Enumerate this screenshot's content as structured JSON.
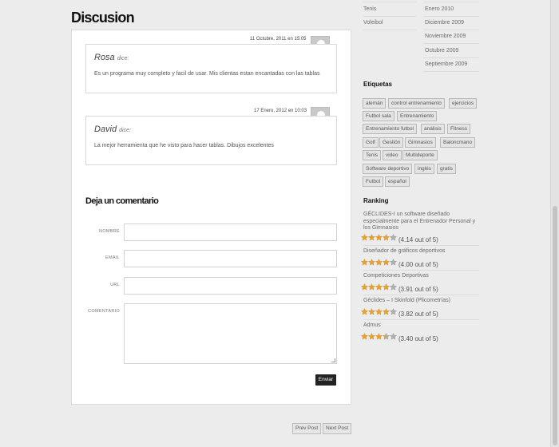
{
  "page": {
    "title": "Discusion"
  },
  "comments": [
    {
      "date": "11 Octubre, 2011 en 15:05",
      "author": "Rosa",
      "says": "dice:",
      "text": "Es un programa muy completo y facil de usar. Mis clientas estan encantadas con las tablas"
    },
    {
      "date": "17 Enero, 2012 en 10:03",
      "author": "David",
      "says": "dice:",
      "text": "La mejor herramienta que he visto para hacer tablas. Dibujos excelentes"
    }
  ],
  "form": {
    "title": "Deja un comentario",
    "labels": {
      "name": "NOMBRE",
      "email": "EMAIL",
      "url": "URL",
      "comment": "COMENTARIO"
    },
    "submit": "Enviar"
  },
  "pagination": {
    "prev": "Prev Post",
    "next": "Next Post"
  },
  "sidebar": {
    "categories": [
      "Tenis",
      "Voleibol"
    ],
    "archives": [
      "Enero 2010",
      "Diciembre 2009",
      "Noviembre 2009",
      "Octubre 2009",
      "Septiembre 2009"
    ],
    "tags_title": "Etiquetas",
    "tags": [
      "alemán",
      "control entrenamiento",
      "ejercicios",
      "Futbol sala",
      "Entrenamiento",
      "Entrenamiento futbol",
      "análisis",
      "Fitness",
      "Golf",
      "Gestión",
      "Gimnasios",
      "Baloncmano",
      "Tenis",
      "video",
      "Multideporte",
      "Software deportivo",
      "inglés",
      "gratis",
      "Futbol",
      "español"
    ],
    "ranking_title": "Ranking",
    "ranking": [
      {
        "name": "GÉCLIDES-I un software diseñado especialmente para el Entrenador Personal y los Gimnasios",
        "score": "(4.14 out of 5)",
        "rating": 4.14
      },
      {
        "name": "Diseñador de gráficos deportivos",
        "score": "(4.00 out of 5)",
        "rating": 4.0
      },
      {
        "name": "Competiciones Deportivas",
        "score": "(3.91 out of 5)",
        "rating": 3.91
      },
      {
        "name": "Géclides – I Skinfold (Plicometrías)",
        "score": "(3.82 out of 5)",
        "rating": 3.82
      },
      {
        "name": "Admus",
        "score": "(3.40 out of 5)",
        "rating": 3.4
      }
    ]
  },
  "colors": {
    "star_fill": "#f0a020",
    "star_empty": "#b0b0b0",
    "button_dark": "#222222"
  }
}
